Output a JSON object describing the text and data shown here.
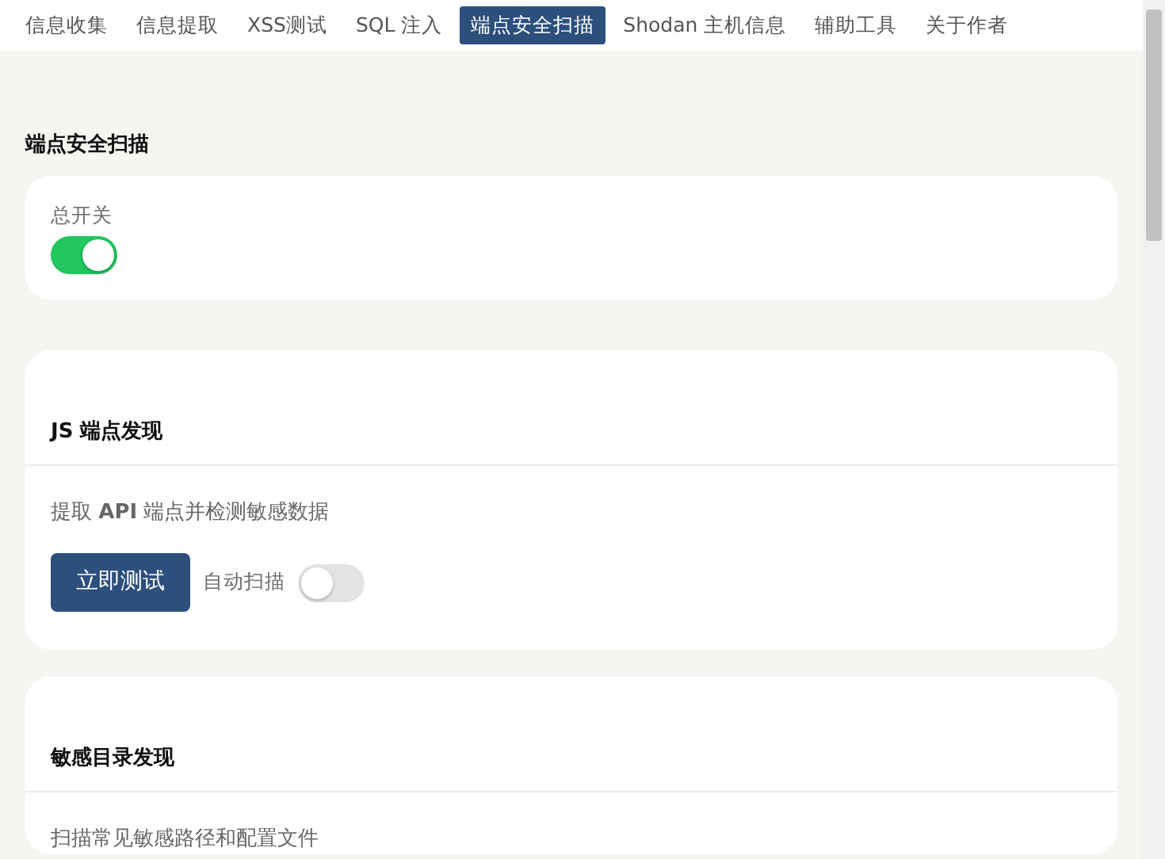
{
  "tabs": [
    {
      "label": "信息收集",
      "selected": false
    },
    {
      "label": "信息提取",
      "selected": false
    },
    {
      "label": "XSS测试",
      "selected": false
    },
    {
      "label": "SQL 注入",
      "selected": false
    },
    {
      "label": "端点安全扫描",
      "selected": true
    },
    {
      "label": "Shodan 主机信息",
      "selected": false
    },
    {
      "label": "辅助工具",
      "selected": false
    },
    {
      "label": "关于作者",
      "selected": false
    }
  ],
  "section_title": "端点安全扫描",
  "master_switch": {
    "label": "总开关",
    "on": true
  },
  "cards": [
    {
      "title": "JS 端点发现",
      "description": "提取 **API** 端点并检测敏感数据",
      "button": "立即测试",
      "auto_scan": {
        "label": "自动扫描",
        "on": false
      }
    },
    {
      "title": "敏感目录发现",
      "description": "扫描常见敏感路径和配置文件"
    }
  ]
}
